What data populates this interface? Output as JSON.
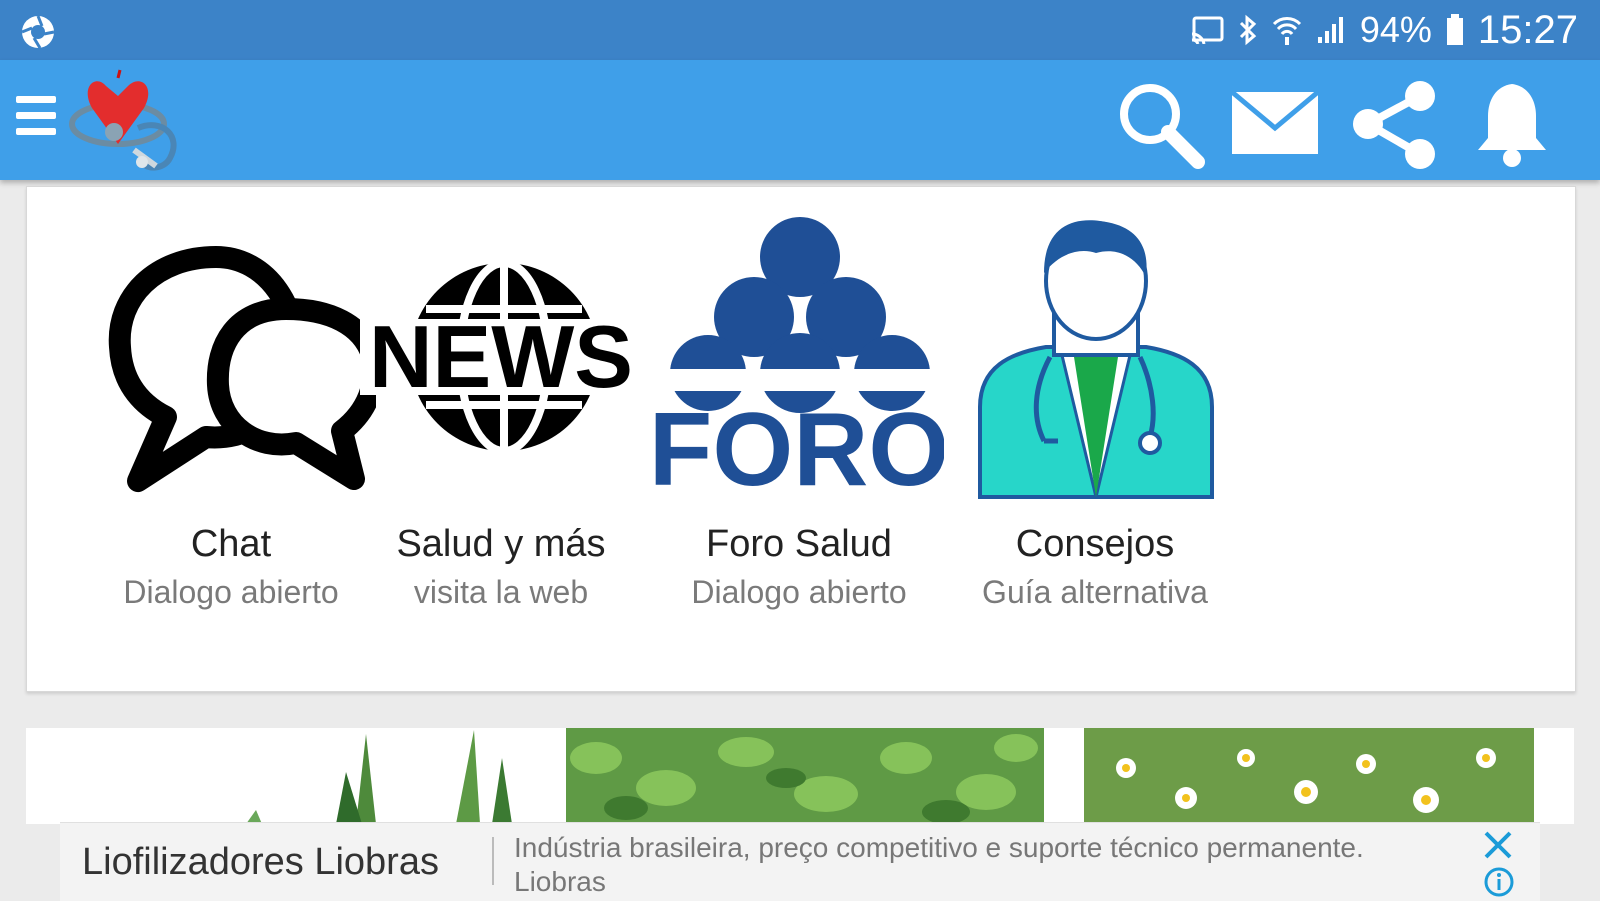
{
  "status_bar": {
    "battery_percent": "94%",
    "time": "15:27",
    "icons": [
      "aperture-icon",
      "cast-icon",
      "bluetooth-icon",
      "wifi-icon",
      "signal-icon",
      "battery-icon"
    ]
  },
  "app_bar": {
    "color": "#3f9fe9",
    "icons": [
      "menu-icon",
      "app-logo",
      "search-icon",
      "mail-icon",
      "share-icon",
      "bell-icon"
    ]
  },
  "menu_tiles": [
    {
      "title": "Chat",
      "subtitle": "Dialogo abierto",
      "icon": "chat-bubbles-icon"
    },
    {
      "title": "Salud y más",
      "subtitle": "visita la web",
      "icon": "news-globe-icon",
      "icon_text": "NEWS"
    },
    {
      "title": "Foro Salud",
      "subtitle": "Dialogo abierto",
      "icon": "foro-icon",
      "icon_text": "FORO"
    },
    {
      "title": "Consejos",
      "subtitle": "Guía alternativa",
      "icon": "doctor-icon"
    }
  ],
  "banner": {
    "images": [
      "aloe-plant",
      "mint-leaves",
      "chamomile-flowers"
    ]
  },
  "ad": {
    "title": "Liofilizadores Liobras",
    "body_line1": "Indústria brasileira, preço competitivo e suporte técnico permanente.",
    "body_line2": "Liobras",
    "icons": [
      "close-icon",
      "info-icon"
    ]
  },
  "colors": {
    "status_bar": "#3c83c8",
    "app_bar": "#3f9fe9",
    "foro_blue": "#1f4f96",
    "doctor_teal": "#27d6c9"
  }
}
